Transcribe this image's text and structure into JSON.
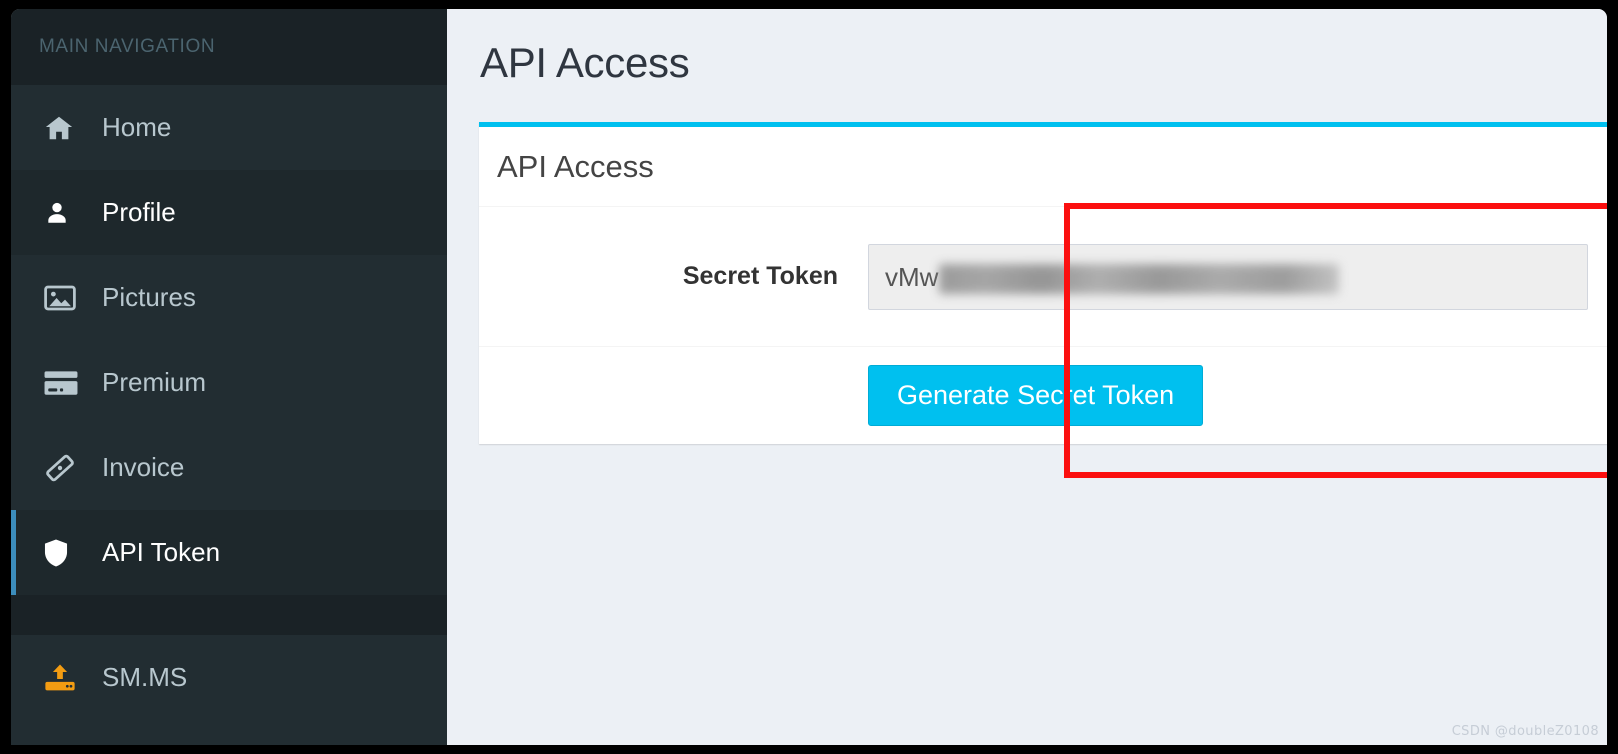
{
  "sidebar": {
    "header": "MAIN NAVIGATION",
    "items": [
      {
        "label": "Home",
        "icon": "home-icon",
        "state": "normal"
      },
      {
        "label": "Profile",
        "icon": "user-icon",
        "state": "hovered"
      },
      {
        "label": "Pictures",
        "icon": "image-icon",
        "state": "normal"
      },
      {
        "label": "Premium",
        "icon": "credit-card-icon",
        "state": "normal"
      },
      {
        "label": "Invoice",
        "icon": "ticket-icon",
        "state": "normal"
      },
      {
        "label": "API Token",
        "icon": "shield-icon",
        "state": "active"
      },
      {
        "label": "SM.MS",
        "icon": "upload-hdd-icon",
        "state": "normal"
      }
    ],
    "active_item": "API Token",
    "accent_color": "#3c8dbc",
    "background_color": "#222d32",
    "header_background_color": "#1a2226",
    "smms_icon_color": "#f39c12"
  },
  "main": {
    "page_title": "API Access",
    "box": {
      "title": "API Access",
      "top_border_color": "#00c0ef",
      "rows": [
        {
          "label": "Secret Token",
          "field_name": "secret-token-input",
          "value_visible": "vMw",
          "value_redacted": true,
          "readonly": true
        }
      ],
      "button": {
        "label": "Generate Secret Token",
        "color": "#00c0ef",
        "text_color": "#ffffff"
      }
    }
  },
  "annotation": {
    "type": "rectangle-highlight",
    "color": "#fb0f0f",
    "encloses": "Secret Token field and Generate Secret Token button"
  },
  "watermark": {
    "text": "CSDN @doubleZ0108"
  }
}
